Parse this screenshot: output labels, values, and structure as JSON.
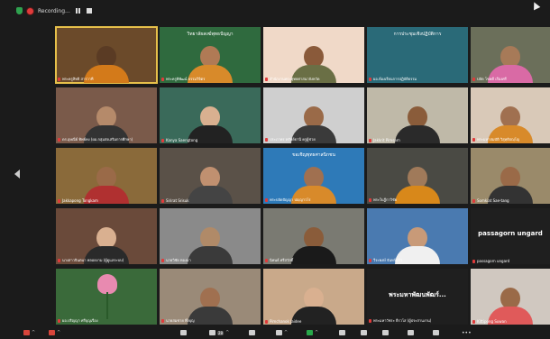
{
  "recording": {
    "label": "Recording..."
  },
  "participants": [
    {
      "name": "พระครูสิทธิ สารวาที",
      "bg": "#6b4a2a",
      "skin": "#5a3b24",
      "shirt": "#d37a1a",
      "active": true
    },
    {
      "name": "พระครูพิพัฒน์ ธรรมวิจิตร",
      "bg": "#2f6a3e",
      "skin": "#b07a55",
      "shirt": "#d88a2a",
      "slide": "วิทยาลัยสงฆ์พุทธปัญญา"
    },
    {
      "name": "สำนักงานพระพุทธศาสนาจังหวัด",
      "bg": "#f0d9c8",
      "skin": "#8a5a3a",
      "shirt": "#6a6f45"
    },
    {
      "name": "ผอ.ห้องเรียนการปฏิบัติธรรม",
      "bg": "#2a6a78",
      "skin": "#2a6a78",
      "shirt": "#2a6a78",
      "slide": "การประชุมเชิงปฏิบัติการ"
    },
    {
      "name": "ปลัด โชคดี เรืองศรี",
      "bg": "#6b6f5a",
      "skin": "#a77a58",
      "shirt": "#d96aa5"
    },
    {
      "name": "ดร.อุษณีย์ ทิพย์คง (ผอ.กลุ่มส่งเสริมการศึกษา)",
      "bg": "#7a5a4a",
      "skin": "#b58a6a",
      "shirt": "#333"
    },
    {
      "name": "Kanya Saengtong",
      "bg": "#3a6a5a",
      "skin": "#d9b090",
      "shirt": "#222"
    },
    {
      "name": "ประภาพร ทรัพย์ธานี ครูผู้ช่วย",
      "bg": "#cfcfcf",
      "skin": "#9a6a48",
      "shirt": "#3a3a3a"
    },
    {
      "name": "Jakkrit Pimsarn",
      "bg": "#bfb9a8",
      "skin": "#8a5c3a",
      "shirt": "#2a2a2a"
    },
    {
      "name": "พระมหาสมบัติ วิสุทฺธิปญฺโญ",
      "bg": "#d9c9b8",
      "skin": "#a07050",
      "shirt": "#d88a2a"
    },
    {
      "name": "Jakkapong Tongkam",
      "bg": "#8a6a3a",
      "skin": "#9a6a48",
      "shirt": "#b03030"
    },
    {
      "name": "Sirirat Srisuk",
      "bg": "#5a5148",
      "skin": "#c09070",
      "shirt": "#444"
    },
    {
      "name": "พระปลัดปัญญา ปญฺญาวโร",
      "bg": "#2e7ab8",
      "skin": "#a07050",
      "shirt": "#d88a2a",
      "slide": "ขอเชิญพุทธศาสนิกชน"
    },
    {
      "name": "พระใบฎีกาวิชัย",
      "bg": "#4a4a44",
      "skin": "#a07a5a",
      "shirt": "#d8881a"
    },
    {
      "name": "Somkiat Sae-tang",
      "bg": "#9a8a6a",
      "skin": "#9a6a48",
      "shirt": "#333"
    },
    {
      "name": "นางสาวจินตนา พลอยงาม (ผู้ดูแลระบบ)",
      "bg": "#6a4a3a",
      "skin": "#d9b090",
      "shirt": "#2a2a2a"
    },
    {
      "name": "นายวิชัย ทองมา",
      "bg": "#8a8a8a",
      "skin": "#b08a68",
      "shirt": "#3a3a3a"
    },
    {
      "name": "นิพนธ์ ศรีสวัสดิ์",
      "bg": "#7a7a72",
      "skin": "#8a5c3a",
      "shirt": "#1a1a1a"
    },
    {
      "name": "วีระพงษ์ จันทร์แก้ว",
      "bg": "#4a7ab0",
      "skin": "#c89a78",
      "shirt": "#f0f0f0"
    },
    {
      "name": "passagorn ungard",
      "bg": "#1f1f1f",
      "textname": "passagorn ungard"
    },
    {
      "name": "ผอ.ปริญญา ศรีบุญเรือง",
      "bg": "#3a6a3a",
      "skin": "#3a6a3a",
      "shirt": "#3a6a3a",
      "lotus": true
    },
    {
      "name": "นายสมชาย พึ่งบุญ",
      "bg": "#9a8a78",
      "skin": "#a07050",
      "shirt": "#3a3a3a"
    },
    {
      "name": "Pimchanok Jaidee",
      "bg": "#c9a98a",
      "skin": "#d9b090",
      "shirt": "#222"
    },
    {
      "name": "พระมหาวัชระ ธีรวโส (ผู้ประสานงาน)",
      "bg": "#1f1f1f",
      "textname": "พระมหาพัฒนพัฒร์..."
    },
    {
      "name": "Kittipong Suwan",
      "bg": "#d0c8c0",
      "skin": "#9a6a48",
      "shirt": "#e05a5a"
    }
  ],
  "toolbar": {
    "mute": "Unmute",
    "video": "Start Video",
    "security": "Security",
    "participants_count": "28",
    "chat": "Chat",
    "share": "Share",
    "record": "Record",
    "reactions": "Reactions",
    "apps": "Apps",
    "whiteboards": "Whiteboards",
    "more": "More"
  }
}
